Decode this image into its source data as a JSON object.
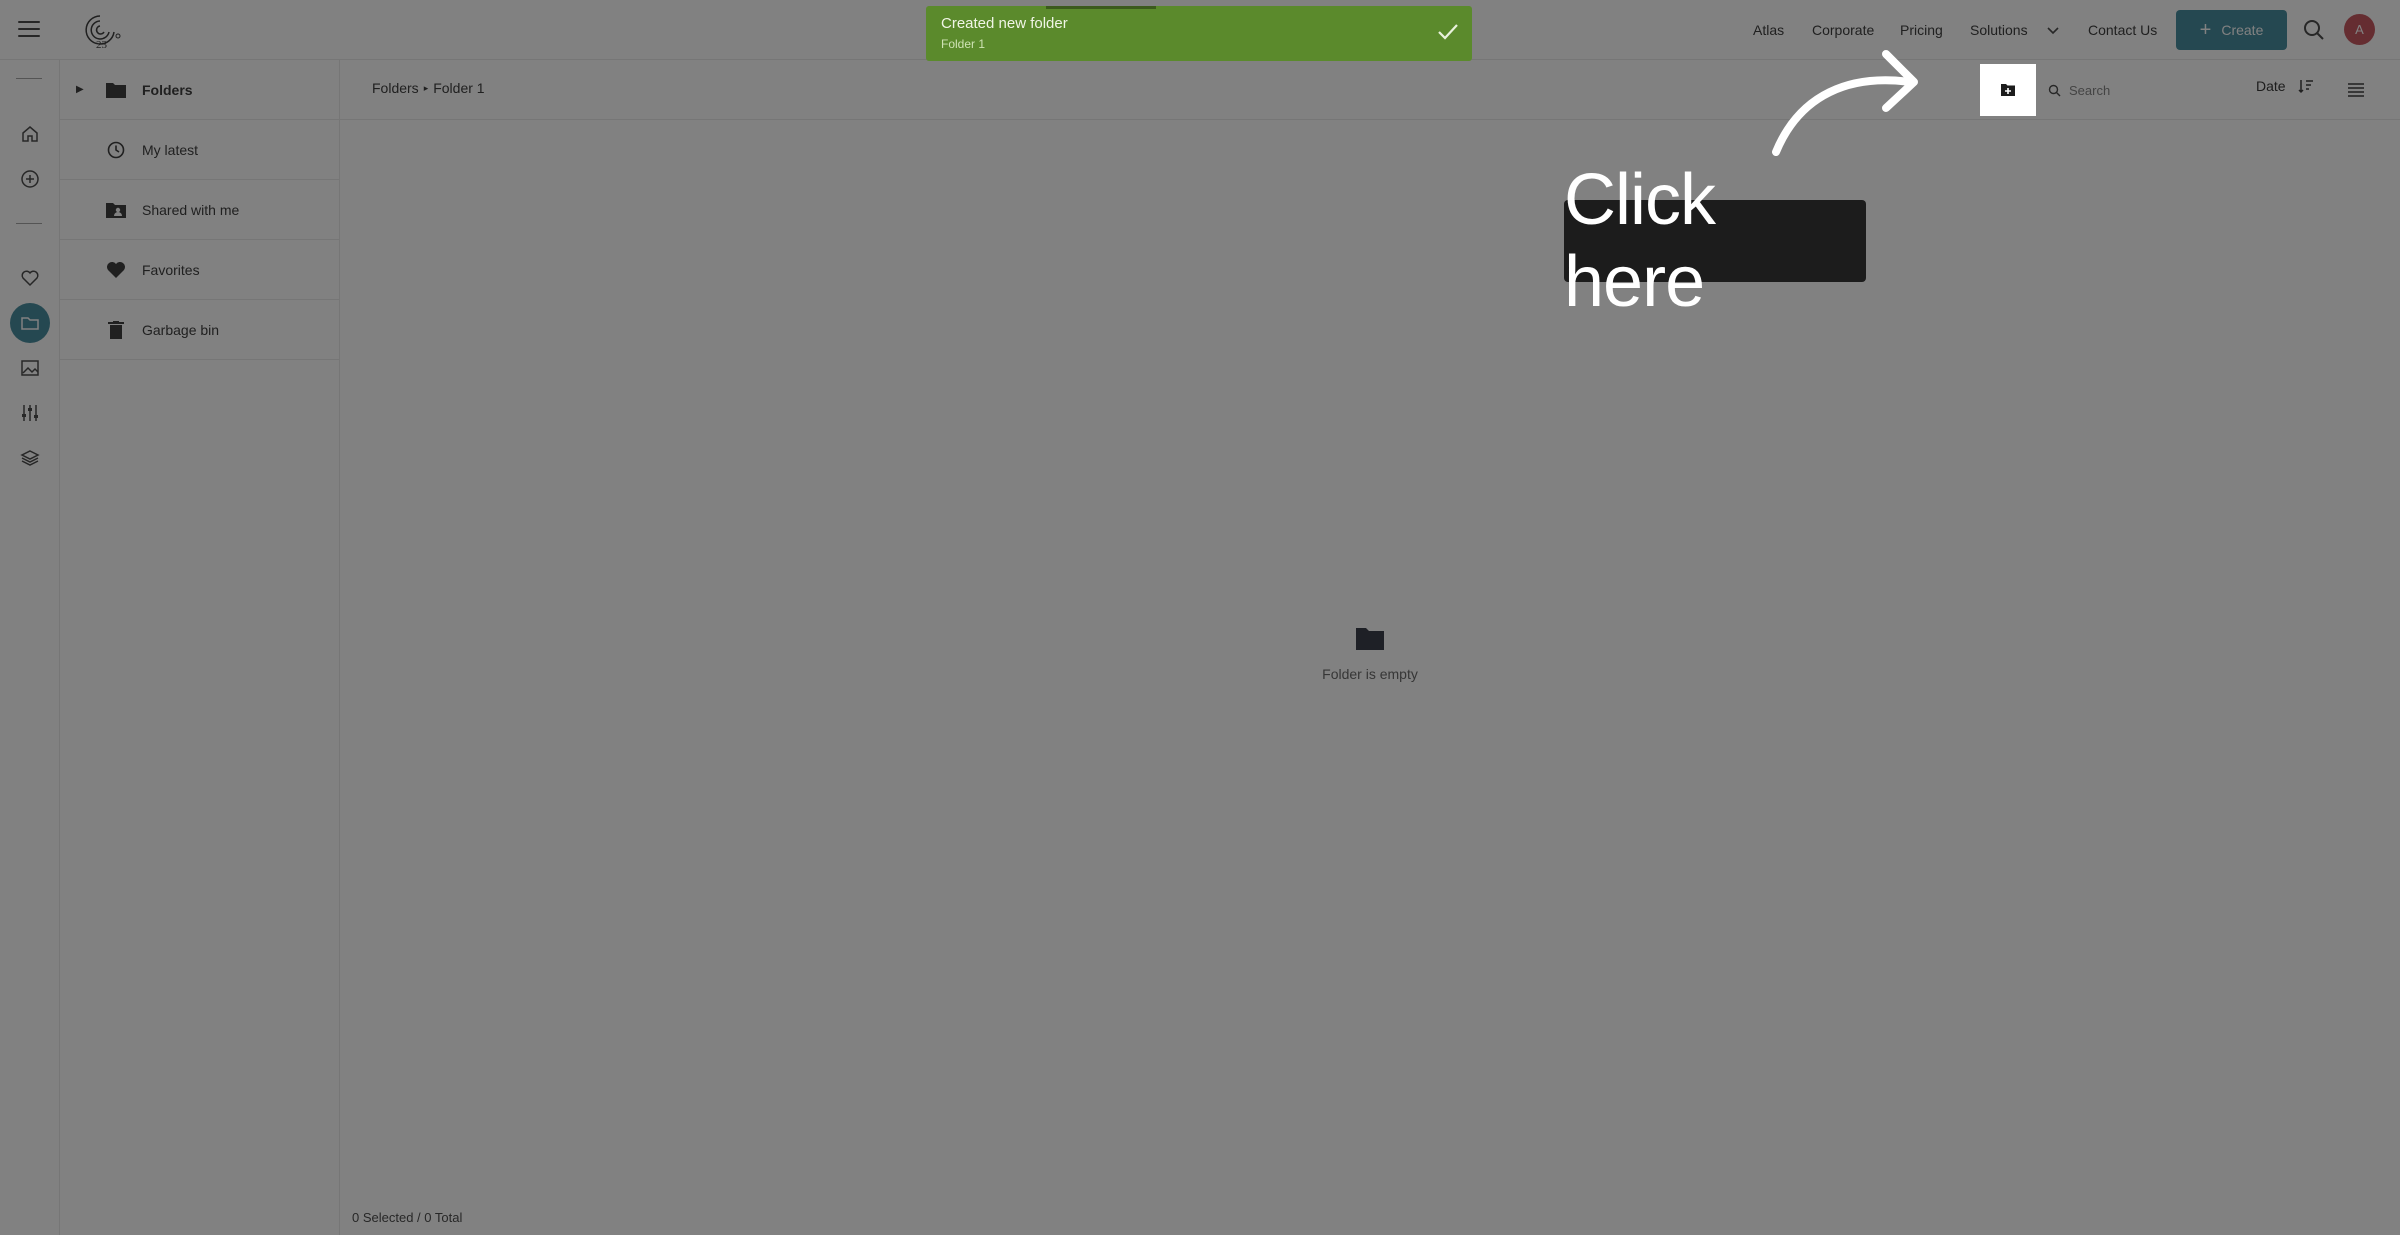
{
  "header": {
    "nav": [
      "Atlas",
      "Corporate",
      "Pricing",
      "Solutions",
      "Contact Us"
    ],
    "create_label": "Create",
    "avatar_initial": "A"
  },
  "sidebar": {
    "items": [
      {
        "label": "Folders",
        "icon": "folder-icon"
      },
      {
        "label": "My latest",
        "icon": "clock-icon"
      },
      {
        "label": "Shared with me",
        "icon": "shared-folder-icon"
      },
      {
        "label": "Favorites",
        "icon": "heart-icon"
      },
      {
        "label": "Garbage bin",
        "icon": "trash-icon"
      }
    ]
  },
  "breadcrumb": {
    "root": "Folders",
    "current": "Folder 1"
  },
  "toolbar": {
    "search_placeholder": "Search",
    "sort_label": "Date"
  },
  "empty_state": {
    "message": "Folder is empty"
  },
  "status": {
    "selection": "0 Selected / 0 Total"
  },
  "toast": {
    "title": "Created new folder",
    "subtitle": "Folder 1",
    "color": "#5b8a2c"
  },
  "tutorial": {
    "callout": "Click here"
  },
  "colors": {
    "accent": "#2e7d91",
    "avatar": "#c0404a"
  }
}
